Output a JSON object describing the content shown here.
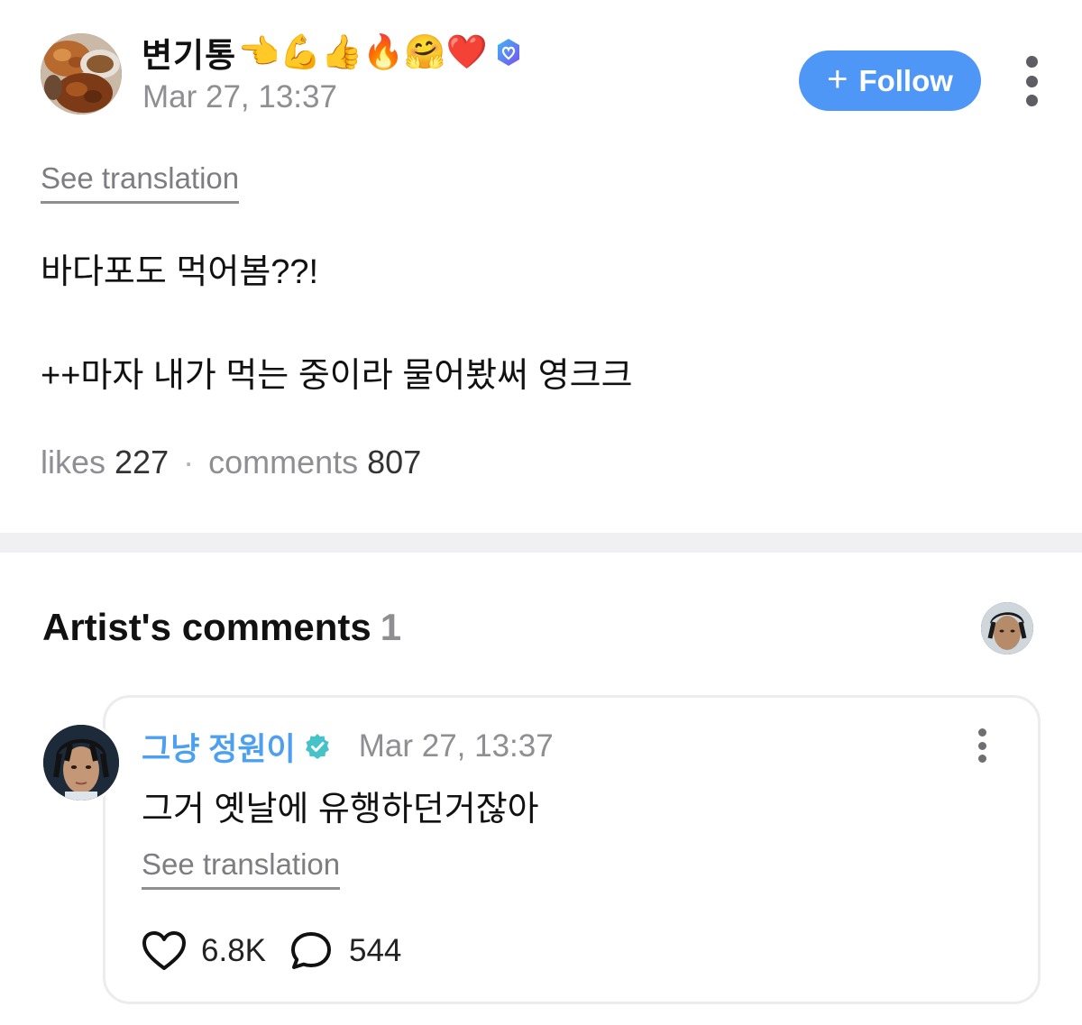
{
  "post": {
    "author": {
      "name": "변기통",
      "emoji": "👈💪👍🔥🤗❤️",
      "badge_icon": "verified-heart-badge-icon",
      "avatar_icon": "food-photo-avatar"
    },
    "timestamp": "Mar 27, 13:37",
    "follow_button": {
      "icon": "plus",
      "label": "Follow"
    },
    "more_icon": "more-vertical-icon",
    "see_translation": "See translation",
    "body_line1": "바다포도 먹어봄??!",
    "body_line2": "++마자 내가 먹는 중이라 물어봤써 영크크",
    "stats": {
      "likes_label": "likes",
      "likes_value": "227",
      "separator": "·",
      "comments_label": "comments",
      "comments_value": "807"
    }
  },
  "artist_comments": {
    "title": "Artist's comments",
    "count": "1",
    "comment": {
      "author": "그냥 정원이",
      "badge_icon": "artist-verified-badge-icon",
      "timestamp": "Mar 27, 13:37",
      "text": "그거 옛날에 유행하던거잖아",
      "see_translation": "See translation",
      "likes": "6.8K",
      "replies": "544"
    }
  },
  "colors": {
    "accent_blue": "#4f97f7",
    "artist_name_blue": "#4da0f0",
    "muted_gray": "#8e8e93",
    "divider": "#f0f0f3"
  }
}
